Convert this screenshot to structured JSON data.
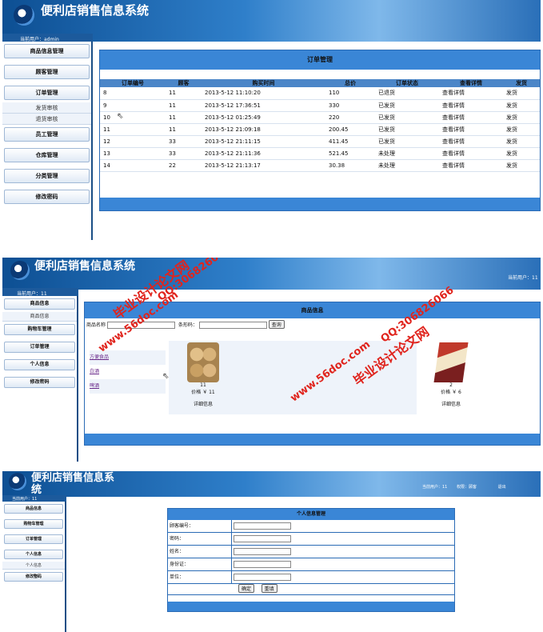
{
  "app_title": "便利店销售信息系统",
  "screen1": {
    "current_user_label": "当前用户：admin",
    "menu": [
      "商品信息管理",
      "顾客管理",
      "订单管理",
      "员工管理",
      "仓库管理",
      "分类管理",
      "修改密码"
    ],
    "order_submenu": [
      "发货审核",
      "退货审核"
    ],
    "panel_title": "订单管理",
    "columns": [
      "订单编号",
      "顾客",
      "购买时间",
      "总价",
      "订单状态",
      "查看详情",
      "发货"
    ],
    "rows": [
      [
        "8",
        "11",
        "2013-5-12 11:10:20",
        "110",
        "已退货",
        "查看详情",
        "发货"
      ],
      [
        "9",
        "11",
        "2013-5-12 17:36:51",
        "330",
        "已发货",
        "查看详情",
        "发货"
      ],
      [
        "10",
        "11",
        "2013-5-12 01:25:49",
        "220",
        "已发货",
        "查看详情",
        "发货"
      ],
      [
        "11",
        "11",
        "2013-5-12 21:09:18",
        "200.45",
        "已发货",
        "查看详情",
        "发货"
      ],
      [
        "12",
        "33",
        "2013-5-12 21:11:15",
        "411.45",
        "已发货",
        "查看详情",
        "发货"
      ],
      [
        "13",
        "33",
        "2013-5-12 21:11:36",
        "521.45",
        "未处理",
        "查看详情",
        "发货"
      ],
      [
        "14",
        "22",
        "2013-5-12 21:13:17",
        "30.38",
        "未处理",
        "查看详情",
        "发货"
      ]
    ]
  },
  "screen2": {
    "current_user_label": "当前用户：11",
    "current_user_right": "当前用户：11",
    "menu": [
      "商品信息",
      "购物车管理",
      "订单管理",
      "个人信息",
      "修改密码"
    ],
    "goods_submenu": [
      "商品信息"
    ],
    "panel_title": "商品信息",
    "search_name_label": "商品名称",
    "search_code_label": "条形码：",
    "search_button": "查询",
    "categories": [
      "方便食品",
      "白酒",
      "啤酒"
    ],
    "products": [
      {
        "name": "11",
        "price_label": "价格",
        "price": "￥ 11",
        "detail": "详细信息"
      },
      {
        "name": "2",
        "price_label": "价格",
        "price": "￥ 6",
        "detail": "详细信息"
      }
    ],
    "watermarks": [
      "毕业设计论文网",
      "www.56doc.com",
      "QQ:306826066"
    ]
  },
  "screen3": {
    "current_user_label": "当前用户：11",
    "topbar": [
      "当前用户：11",
      "权限：顾客",
      "退出"
    ],
    "menu": [
      "商品信息",
      "购物车管理",
      "订单管理",
      "个人信息",
      "修改密码"
    ],
    "personal_submenu": [
      "个人信息"
    ],
    "form_title": "个人信息管理",
    "fields": [
      "顾客编号：",
      "密码：",
      "姓名：",
      "身份证：",
      "单位："
    ],
    "confirm_button": "确定",
    "reset_button": "重填"
  }
}
